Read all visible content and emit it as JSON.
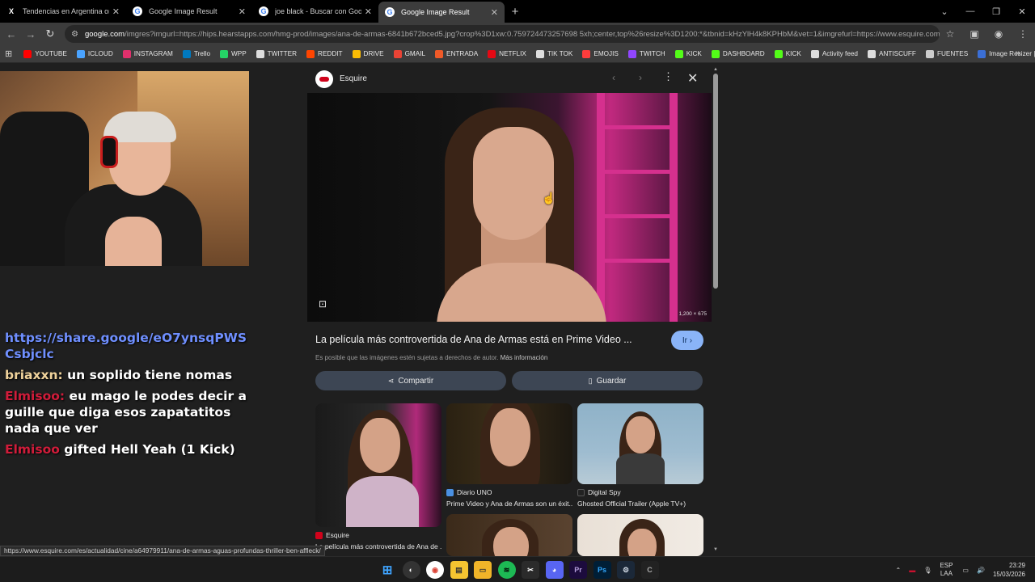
{
  "tabs": [
    {
      "title": "Tendencias en Argentina on X",
      "icon": "x-logo-icon",
      "active": false
    },
    {
      "title": "Google Image Result",
      "icon": "google-icon",
      "active": false
    },
    {
      "title": "joe black - Buscar con Google",
      "icon": "google-icon",
      "active": false
    },
    {
      "title": "Google Image Result",
      "icon": "google-icon",
      "active": true
    }
  ],
  "new_tab": "+",
  "window_controls": {
    "minimize": "—",
    "maximize": "❐",
    "close": "✕",
    "dropdown": "⌄"
  },
  "address_bar": {
    "domain": "google.com",
    "path": "/imgres?imgurl=https://hips.hearstapps.com/hmg-prod/images/ana-de-armas-6841b672bced5.jpg?crop%3D1xw:0.759724473257698 5xh;center,top%26resize%3D1200:*&tbnid=kHzYlH4k8KPHbM&vet=1&imgrefurl=https://www.esquire.com/..."
  },
  "bookmarks": [
    {
      "label": "YOUTUBE",
      "color": "#ff0000"
    },
    {
      "label": "ICLOUD",
      "color": "#4aa3ff"
    },
    {
      "label": "INSTAGRAM",
      "color": "#e1306c"
    },
    {
      "label": "Trello",
      "color": "#0079bf"
    },
    {
      "label": "WPP",
      "color": "#25d366"
    },
    {
      "label": "TWITTER",
      "color": "#dddddd"
    },
    {
      "label": "REDDIT",
      "color": "#ff4500"
    },
    {
      "label": "DRIVE",
      "color": "#fbbc04"
    },
    {
      "label": "GMAIL",
      "color": "#ea4335"
    },
    {
      "label": "ENTRADA",
      "color": "#f05a28"
    },
    {
      "label": "NETFLIX",
      "color": "#e50914"
    },
    {
      "label": "TIK TOK",
      "color": "#dddddd"
    },
    {
      "label": "EMOJIS",
      "color": "#ff3c3c"
    },
    {
      "label": "TWITCH",
      "color": "#9146ff"
    },
    {
      "label": "KICK",
      "color": "#53fc18"
    },
    {
      "label": "DASHBOARD",
      "color": "#53fc18"
    },
    {
      "label": "KICK",
      "color": "#53fc18"
    },
    {
      "label": "Activity feed",
      "color": "#dddddd"
    },
    {
      "label": "ANTISCUFF",
      "color": "#dddddd"
    },
    {
      "label": "FUENTES",
      "color": "#cccccc"
    },
    {
      "label": "Image Resizer | Resi...",
      "color": "#3b6fd6"
    }
  ],
  "chat": {
    "link": "https://share.google/eO7ynsqPWSCsbjclc",
    "messages": [
      {
        "user": "briaxxn:",
        "text": " un soplido tiene nomas",
        "user_color": "#f0d39c"
      },
      {
        "user": "Elmisoo:",
        "text": " eu mago le podes decir a guille que diga esos zapatatitos nada que ver",
        "user_color": "#d11c3a"
      },
      {
        "user": "Elmisoo",
        "text": " gifted Hell Yeah (1 Kick)",
        "user_color": "#d11c3a"
      }
    ]
  },
  "panel": {
    "source_name": "Esquire",
    "image_dimensions": "1,200 × 675",
    "title": "La película más controvertida de Ana de Armas está en Prime Video ...",
    "visit_label": "Ir",
    "copyright_text": "Es posible que las imágenes estén sujetas a derechos de autor.",
    "copyright_link": "Más información",
    "share_label": "Compartir",
    "save_label": "Guardar",
    "related": [
      {
        "source": "Esquire",
        "title": "La película más controvertida de Ana de ...",
        "source_color": "#d0021b"
      },
      {
        "source": "Diario UNO",
        "title": "Prime Video y Ana de Armas son un éxit...",
        "source_color": "#4a90e2"
      },
      {
        "source": "Digital Spy",
        "title": "Ghosted Official Trailer (Apple TV+)",
        "source_color": "#222222"
      }
    ]
  },
  "status_url": "https://www.esquire.com/es/actualidad/cine/a64979911/ana-de-armas-aguas-profundas-thriller-ben-affleck/",
  "taskbar": {
    "language": "ESP",
    "language_sub": "LAA",
    "time": "23:29",
    "date": "15/03/2026"
  }
}
